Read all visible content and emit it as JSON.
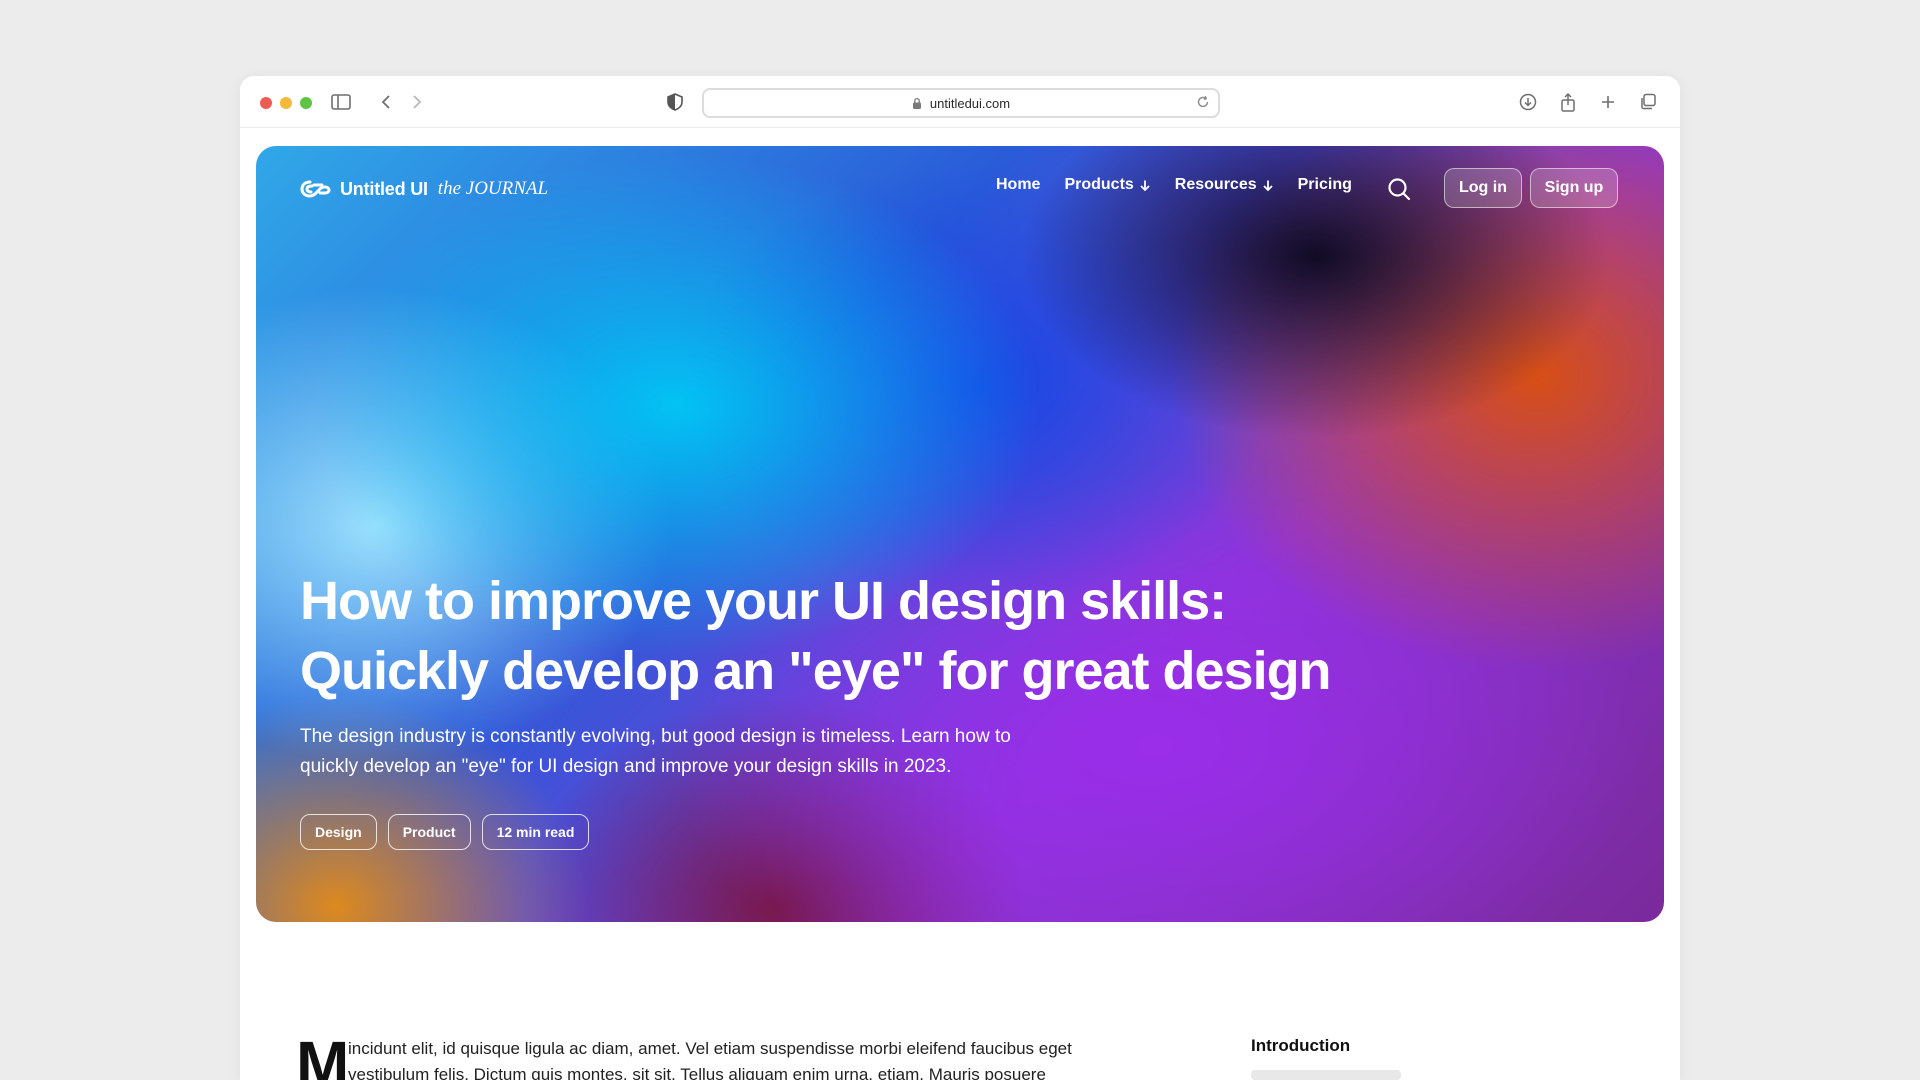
{
  "browser": {
    "url": "untitledui.com"
  },
  "nav": {
    "brand": "Untitled UI",
    "brand_suffix": "the JOURNAL",
    "links": [
      "Home",
      "Products",
      "Resources",
      "Pricing"
    ],
    "login_label": "Log in",
    "signup_label": "Sign up"
  },
  "hero": {
    "title_line1": "How to improve your UI design skills:",
    "title_line2": "Quickly develop an \"eye\" for great design",
    "subtitle_line1": "The design industry is constantly evolving, but good design is timeless. Learn how to",
    "subtitle_line2": "quickly develop an \"eye\" for UI design and improve your design skills in 2023.",
    "tags": [
      "Design",
      "Product",
      "12 min read"
    ]
  },
  "article": {
    "drop_cap": "M",
    "line1": "incidunt elit, id quisque ligula ac diam, amet. Vel etiam suspendisse morbi eleifend faucibus eget",
    "line2": "vestibulum felis. Dictum quis montes, sit sit. Tellus aliquam enim urna, etiam. Mauris posuere"
  },
  "toc": {
    "title": "Introduction"
  },
  "colors": {
    "traffic_red": "#ee5b54",
    "traffic_yellow": "#f2b93b",
    "traffic_green": "#5fc443"
  }
}
